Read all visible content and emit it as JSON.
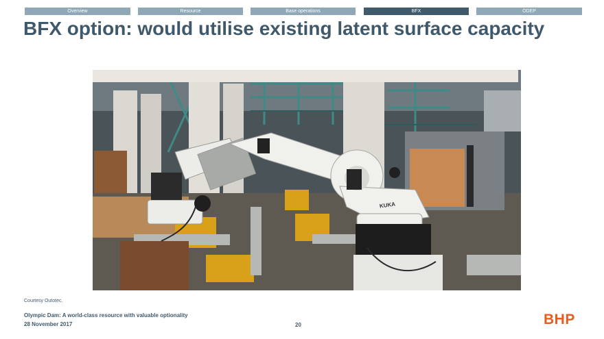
{
  "nav": {
    "tabs": [
      {
        "label": "Overview"
      },
      {
        "label": "Resource"
      },
      {
        "label": "Base operations"
      },
      {
        "label": "BFX"
      },
      {
        "label": "ODEP"
      }
    ],
    "active_index": 3
  },
  "slide": {
    "title": "BFX option: would utilise existing latent surface capacity",
    "photo_caption": "Courtesy Outotec."
  },
  "photo": {
    "robot_brand": "KUKA"
  },
  "footer": {
    "line1": "Olympic Dam: A world-class resource with valuable optionality",
    "line2": "28 November 2017",
    "page_number": "20",
    "logo": "BHP"
  },
  "colors": {
    "title": "#40596a",
    "tab_inactive": "#8fa8b8",
    "tab_active": "#3f5a6b",
    "logo": "#e85d1f"
  }
}
